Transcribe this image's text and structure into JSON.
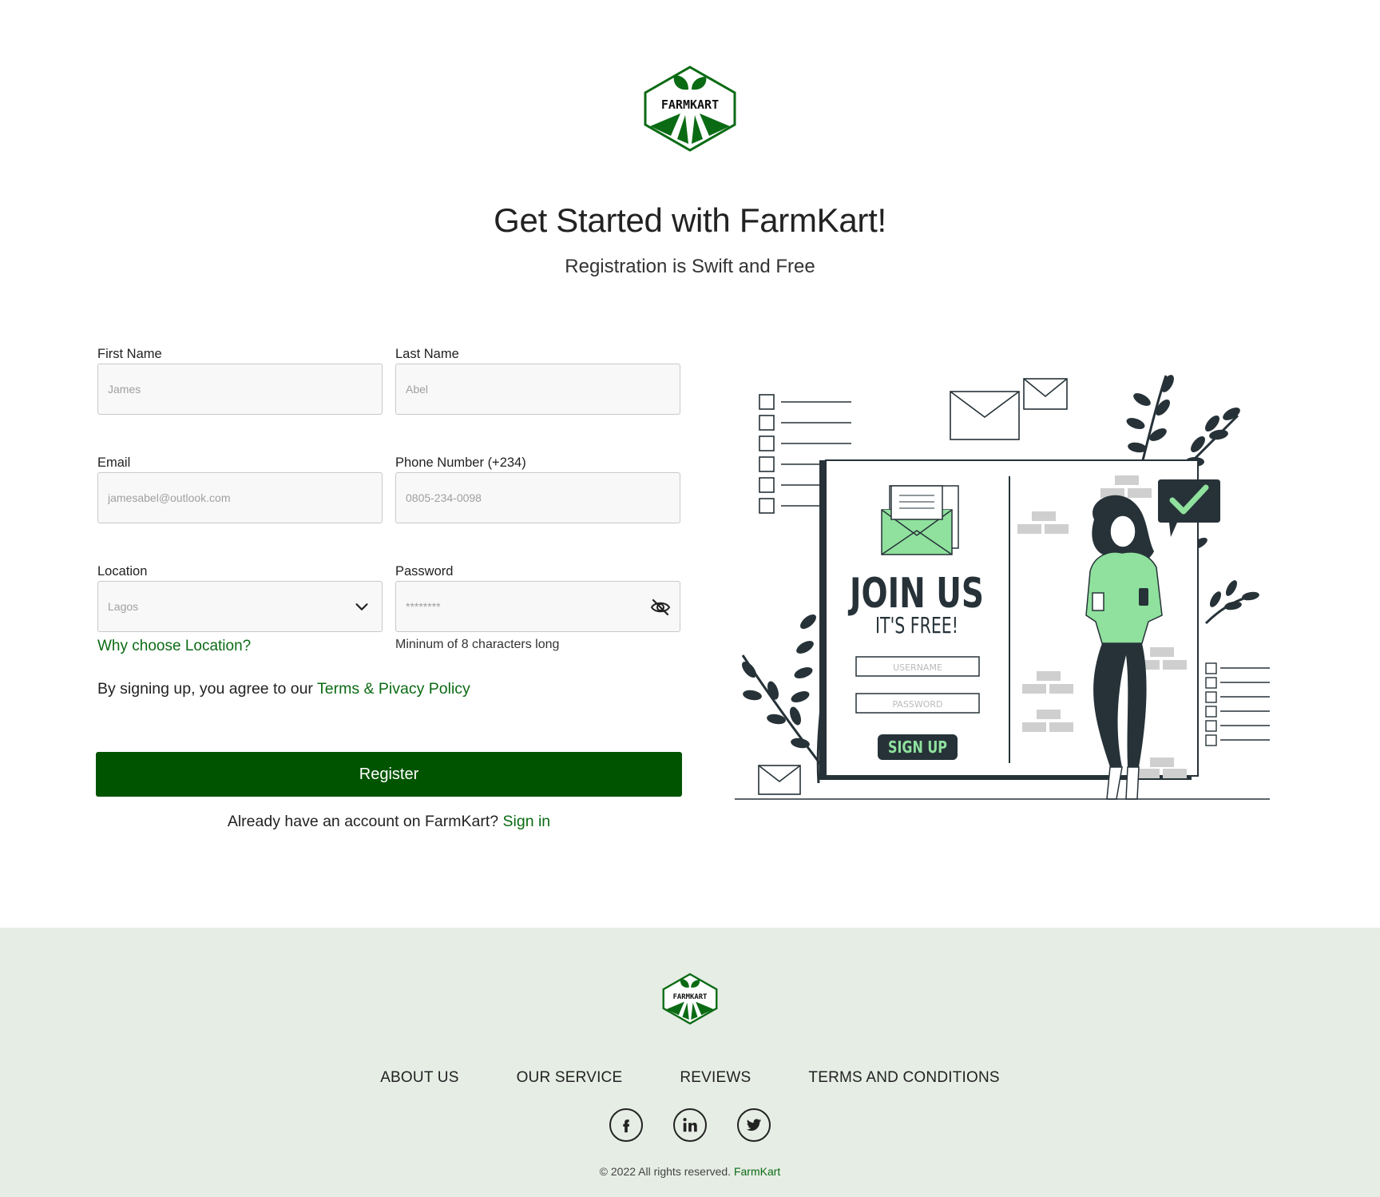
{
  "brand": {
    "name": "FARMKART",
    "accent": "#005400",
    "green": "#0b6b14"
  },
  "header": {
    "title": "Get Started with FarmKart!",
    "subtitle": "Registration is Swift and Free"
  },
  "form": {
    "first_name": {
      "label": "First Name",
      "placeholder": "James"
    },
    "last_name": {
      "label": "Last Name",
      "placeholder": "Abel"
    },
    "email": {
      "label": "Email",
      "placeholder": "jamesabel@outlook.com"
    },
    "phone": {
      "label": "Phone Number (+234)",
      "placeholder": "0805-234-0098"
    },
    "location": {
      "label": "Location",
      "value": "Lagos",
      "help_link": "Why choose Location?"
    },
    "password": {
      "label": "Password",
      "placeholder": "********",
      "hint": "Mininum of 8 characters long"
    },
    "agree_text": "By signing up, you agree to our ",
    "agree_link": "Terms & Pivacy Policy",
    "register_label": "Register",
    "have_account_text": "Already have an account on FarmKart? ",
    "signin_link": "Sign in"
  },
  "illustration": {
    "join": "JOIN US",
    "free": "IT'S FREE!",
    "username": "USERNAME",
    "password": "PASSWORD",
    "signup": "SIGN UP"
  },
  "footer": {
    "nav": [
      "ABOUT US",
      "OUR SERVICE",
      "REVIEWS",
      "TERMS AND CONDITIONS"
    ],
    "socials": [
      "facebook-icon",
      "linkedin-icon",
      "twitter-icon"
    ],
    "copyright_text": "© 2022 All rights reserved. ",
    "copyright_brand": "FarmKart"
  }
}
